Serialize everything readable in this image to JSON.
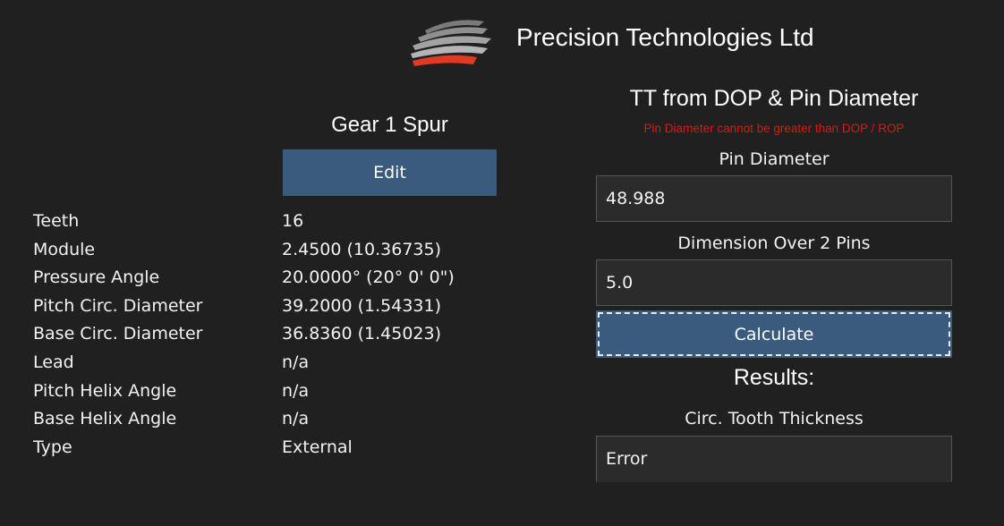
{
  "header": {
    "company_name": "Precision Technologies Ltd",
    "logo_icon": "company-logo-icon",
    "logo_colors": {
      "stripes": "#8a8a8a",
      "accent": "#e03a22"
    }
  },
  "gear_panel": {
    "title": "Gear 1 Spur",
    "edit_label": "Edit",
    "properties": [
      {
        "label": "Teeth",
        "value": "16"
      },
      {
        "label": "Module",
        "value": "2.4500  (10.36735)"
      },
      {
        "label": "Pressure Angle",
        "value": "20.0000° (20° 0' 0\")"
      },
      {
        "label": "Pitch Circ. Diameter",
        "value": "39.2000  (1.54331)"
      },
      {
        "label": "Base Circ. Diameter",
        "value": "36.8360  (1.45023)"
      },
      {
        "label": "Lead",
        "value": "n/a"
      },
      {
        "label": "Pitch Helix Angle",
        "value": "n/a"
      },
      {
        "label": "Base Helix Angle",
        "value": "n/a"
      },
      {
        "label": "Type",
        "value": "External"
      }
    ]
  },
  "calc_panel": {
    "title": "TT from DOP & Pin Diameter",
    "error_message": "Pin Diameter cannot be greater than DOP / ROP",
    "pin_diameter_label": "Pin Diameter",
    "pin_diameter_value": "48.988",
    "dop_label": "Dimension Over 2 Pins",
    "dop_value": "5.0",
    "calculate_label": "Calculate",
    "results_title": "Results:",
    "tooth_thickness_label": "Circ. Tooth Thickness",
    "tooth_thickness_value": "Error"
  },
  "colors": {
    "background": "#202020",
    "button": "#3b5b7e",
    "error": "#e01515",
    "field_background": "#2b2b2b"
  }
}
